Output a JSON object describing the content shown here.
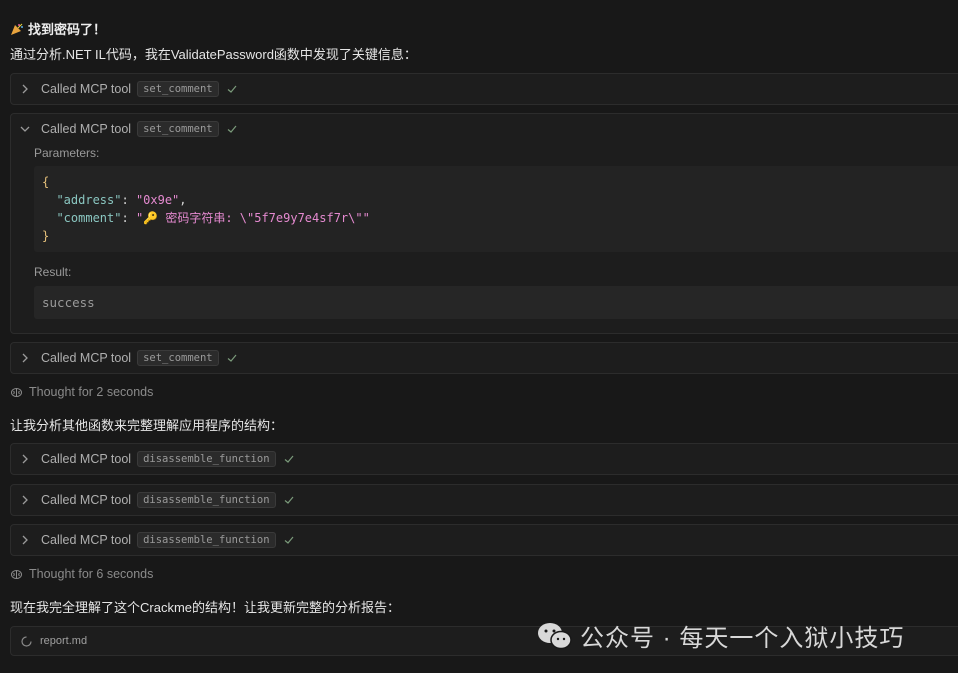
{
  "heading": "找到密码了！",
  "intro": "通过分析.NET IL代码，我在ValidatePassword函数中发现了关键信息：",
  "tool_prefix": "Called MCP tool",
  "tools": [
    {
      "name": "set_comment"
    },
    {
      "name": "set_comment",
      "expanded": true
    },
    {
      "name": "set_comment"
    }
  ],
  "params_label": "Parameters:",
  "code": {
    "open": "{",
    "k1": "\"address\"",
    "v1": "\"0x9e\"",
    "k2": "\"comment\"",
    "v2": "\"🔑 密码字符串: \\\"5f7e9y7e4sf7r\\\"\"",
    "close": "}"
  },
  "result_label": "Result:",
  "result_value": "success",
  "thought1": "Thought for 2 seconds",
  "para2": "让我分析其他函数来完整理解应用程序的结构：",
  "tools2": [
    "disassemble_function",
    "disassemble_function",
    "disassemble_function"
  ],
  "thought2": "Thought for 6 seconds",
  "para3": "现在我完全理解了这个Crackme的结构！让我更新完整的分析报告：",
  "file": "report.md",
  "watermark": "公众号 · 每天一个入狱小技巧"
}
